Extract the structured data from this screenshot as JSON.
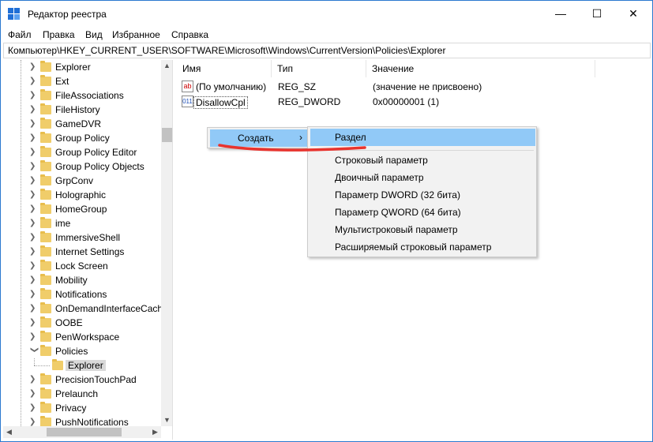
{
  "window": {
    "title": "Редактор реестра"
  },
  "titlebar": {
    "minimize": "—",
    "maximize": "☐",
    "close": "✕"
  },
  "menu": [
    "Файл",
    "Правка",
    "Вид",
    "Избранное",
    "Справка"
  ],
  "address": "Компьютер\\HKEY_CURRENT_USER\\SOFTWARE\\Microsoft\\Windows\\CurrentVersion\\Policies\\Explorer",
  "tree": {
    "items": [
      "Explorer",
      "Ext",
      "FileAssociations",
      "FileHistory",
      "GameDVR",
      "Group Policy",
      "Group Policy Editor",
      "Group Policy Objects",
      "GrpConv",
      "Holographic",
      "HomeGroup",
      "ime",
      "ImmersiveShell",
      "Internet Settings",
      "Lock Screen",
      "Mobility",
      "Notifications",
      "OnDemandInterfaceCach",
      "OOBE",
      "PenWorkspace",
      "Policies"
    ],
    "selected_child": "Explorer",
    "after_items": [
      "PrecisionTouchPad",
      "Prelaunch",
      "Privacy",
      "PushNotifications"
    ]
  },
  "values": {
    "headers": {
      "name": "Имя",
      "type": "Тип",
      "value": "Значение"
    },
    "rows": [
      {
        "icon": "string-value-icon",
        "icon_glyph": "ab",
        "name": "(По умолчанию)",
        "type": "REG_SZ",
        "data": "(значение не присвоено)"
      },
      {
        "icon": "binary-value-icon",
        "icon_glyph": "011",
        "name": "DisallowCpl",
        "type": "REG_DWORD",
        "data": "0x00000001 (1)"
      }
    ]
  },
  "context_menu": {
    "create_label": "Создать",
    "arrow": "›",
    "submenu": [
      "Раздел",
      "Строковый параметр",
      "Двоичный параметр",
      "Параметр DWORD (32 бита)",
      "Параметр QWORD (64 бита)",
      "Мультистроковый параметр",
      "Расширяемый строковый параметр"
    ]
  },
  "colors": {
    "highlight": "#91c9f7",
    "annotation": "#e8332e",
    "folder": "#f0cd6a"
  }
}
